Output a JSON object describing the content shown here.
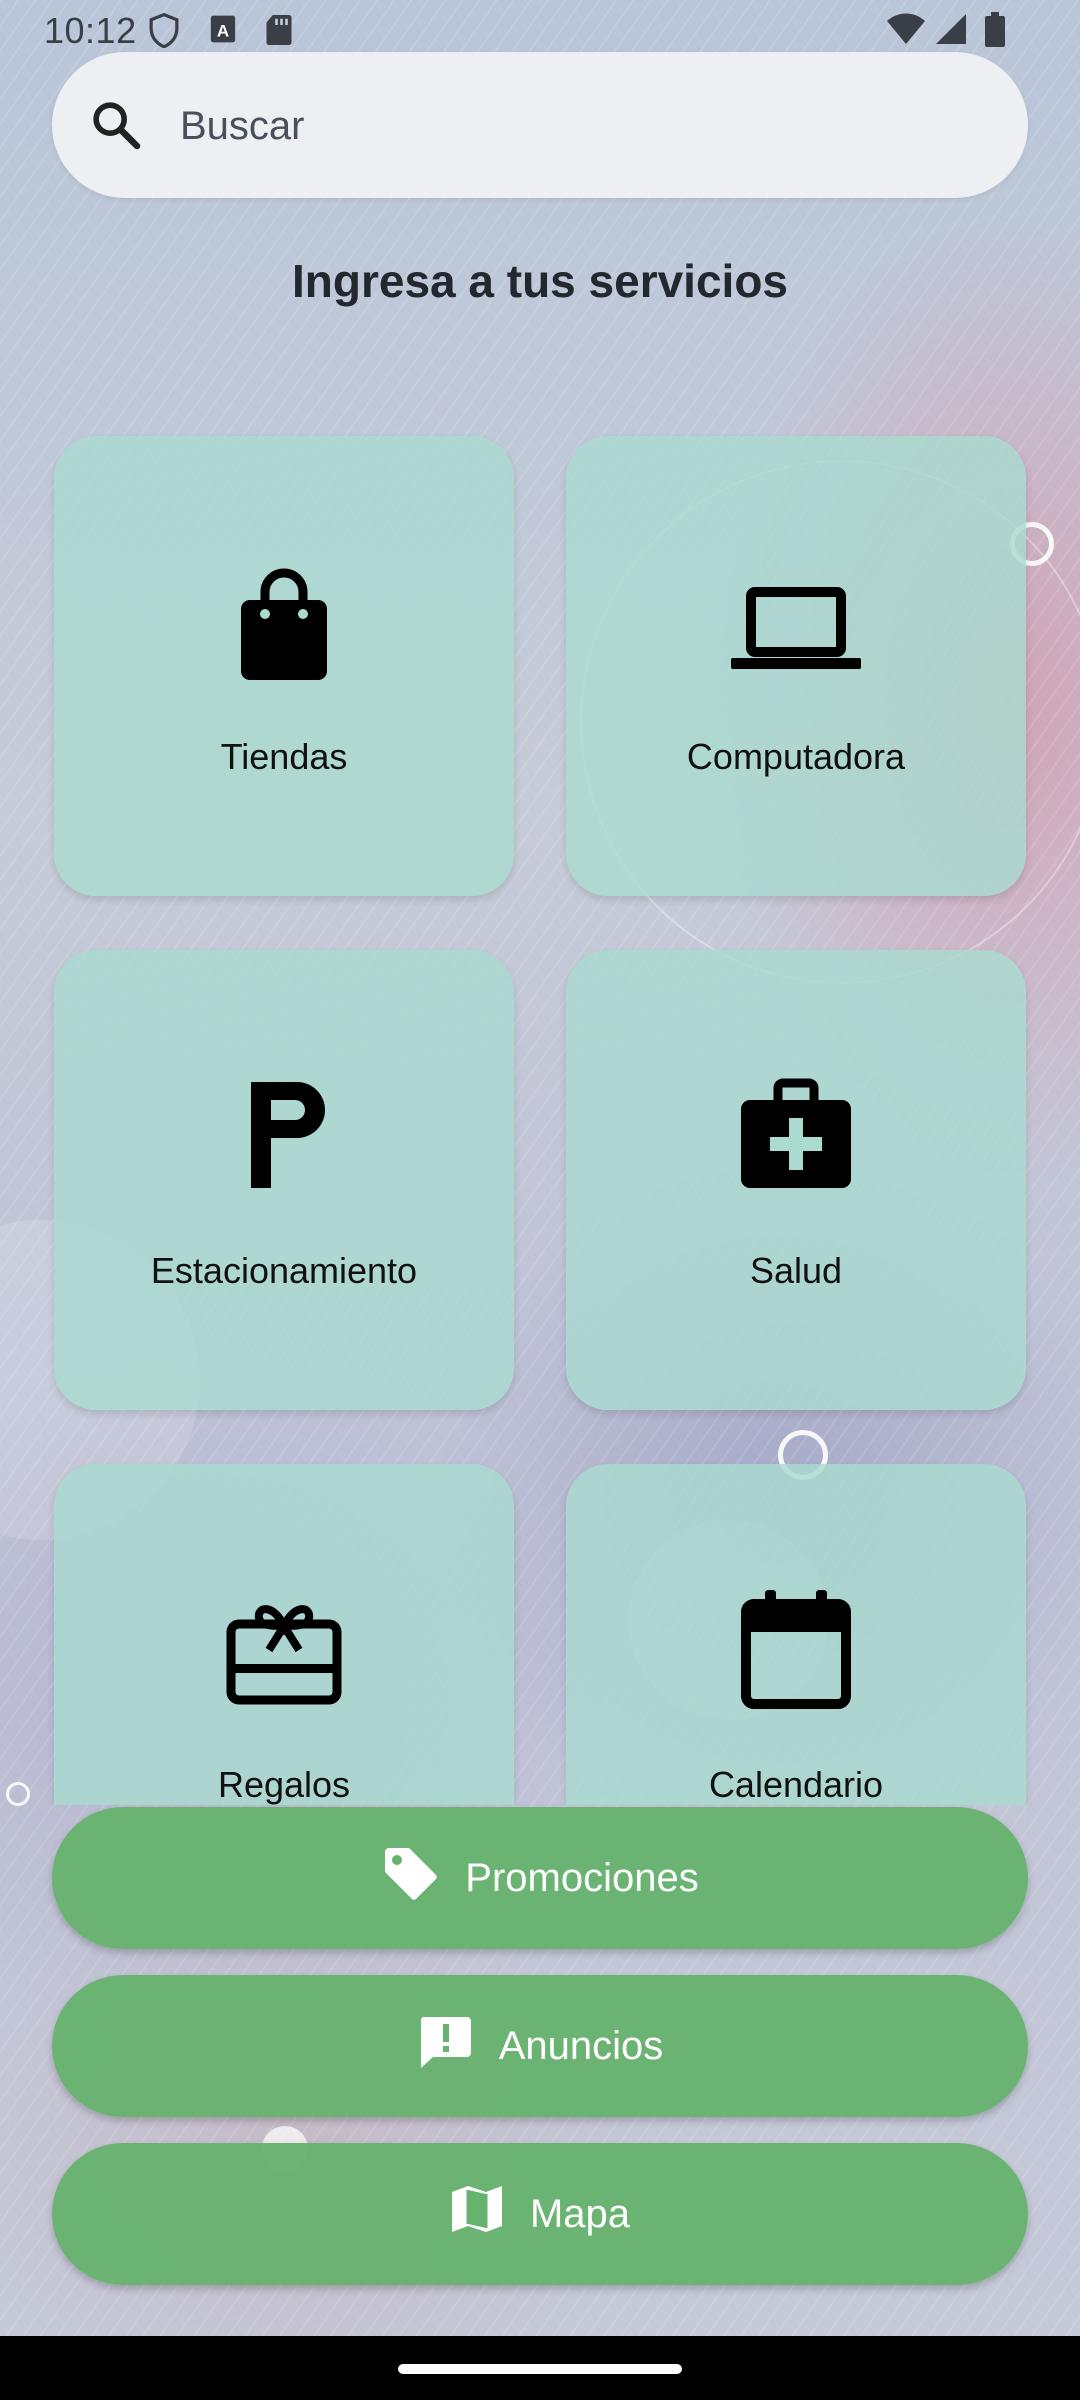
{
  "status_bar": {
    "time": "10:12"
  },
  "search": {
    "placeholder": "Buscar"
  },
  "title": "Ingresa a tus servicios",
  "services": [
    {
      "label": "Tiendas",
      "icon": "shopping-bag-icon"
    },
    {
      "label": "Computadora",
      "icon": "laptop-icon"
    },
    {
      "label": "Estacionamiento",
      "icon": "parking-icon"
    },
    {
      "label": "Salud",
      "icon": "medical-bag-icon"
    },
    {
      "label": "Regalos",
      "icon": "gift-card-icon"
    },
    {
      "label": "Calendario",
      "icon": "calendar-icon"
    }
  ],
  "actions": [
    {
      "label": "Promociones",
      "icon": "tag-icon"
    },
    {
      "label": "Anuncios",
      "icon": "announcement-icon"
    },
    {
      "label": "Mapa",
      "icon": "map-icon"
    }
  ],
  "colors": {
    "tile": "#aadad0",
    "action": "#66b26e",
    "title": "#23282f"
  }
}
